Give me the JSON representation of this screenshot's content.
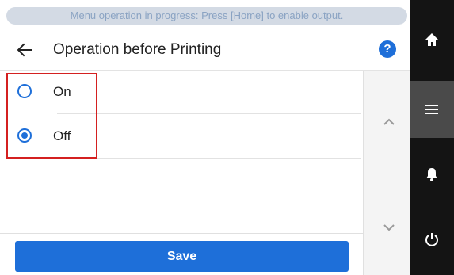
{
  "banner": {
    "text": "Menu operation in progress: Press [Home] to enable output."
  },
  "header": {
    "title": "Operation before Printing",
    "help_label": "?"
  },
  "options": [
    {
      "label": "On",
      "selected": false
    },
    {
      "label": "Off",
      "selected": true
    }
  ],
  "footer": {
    "save_label": "Save"
  },
  "colors": {
    "accent": "#1e6fd9",
    "highlight": "#d42020",
    "sidebar": "#141414",
    "sidebar_active": "#4a4a4a"
  },
  "icons": {
    "back": "arrow-left-icon",
    "help": "question-circle-icon",
    "scroll_up": "chevron-up-icon",
    "scroll_down": "chevron-down-icon",
    "home": "home-icon",
    "menu": "menu-icon",
    "bell": "bell-icon",
    "power": "power-icon"
  }
}
